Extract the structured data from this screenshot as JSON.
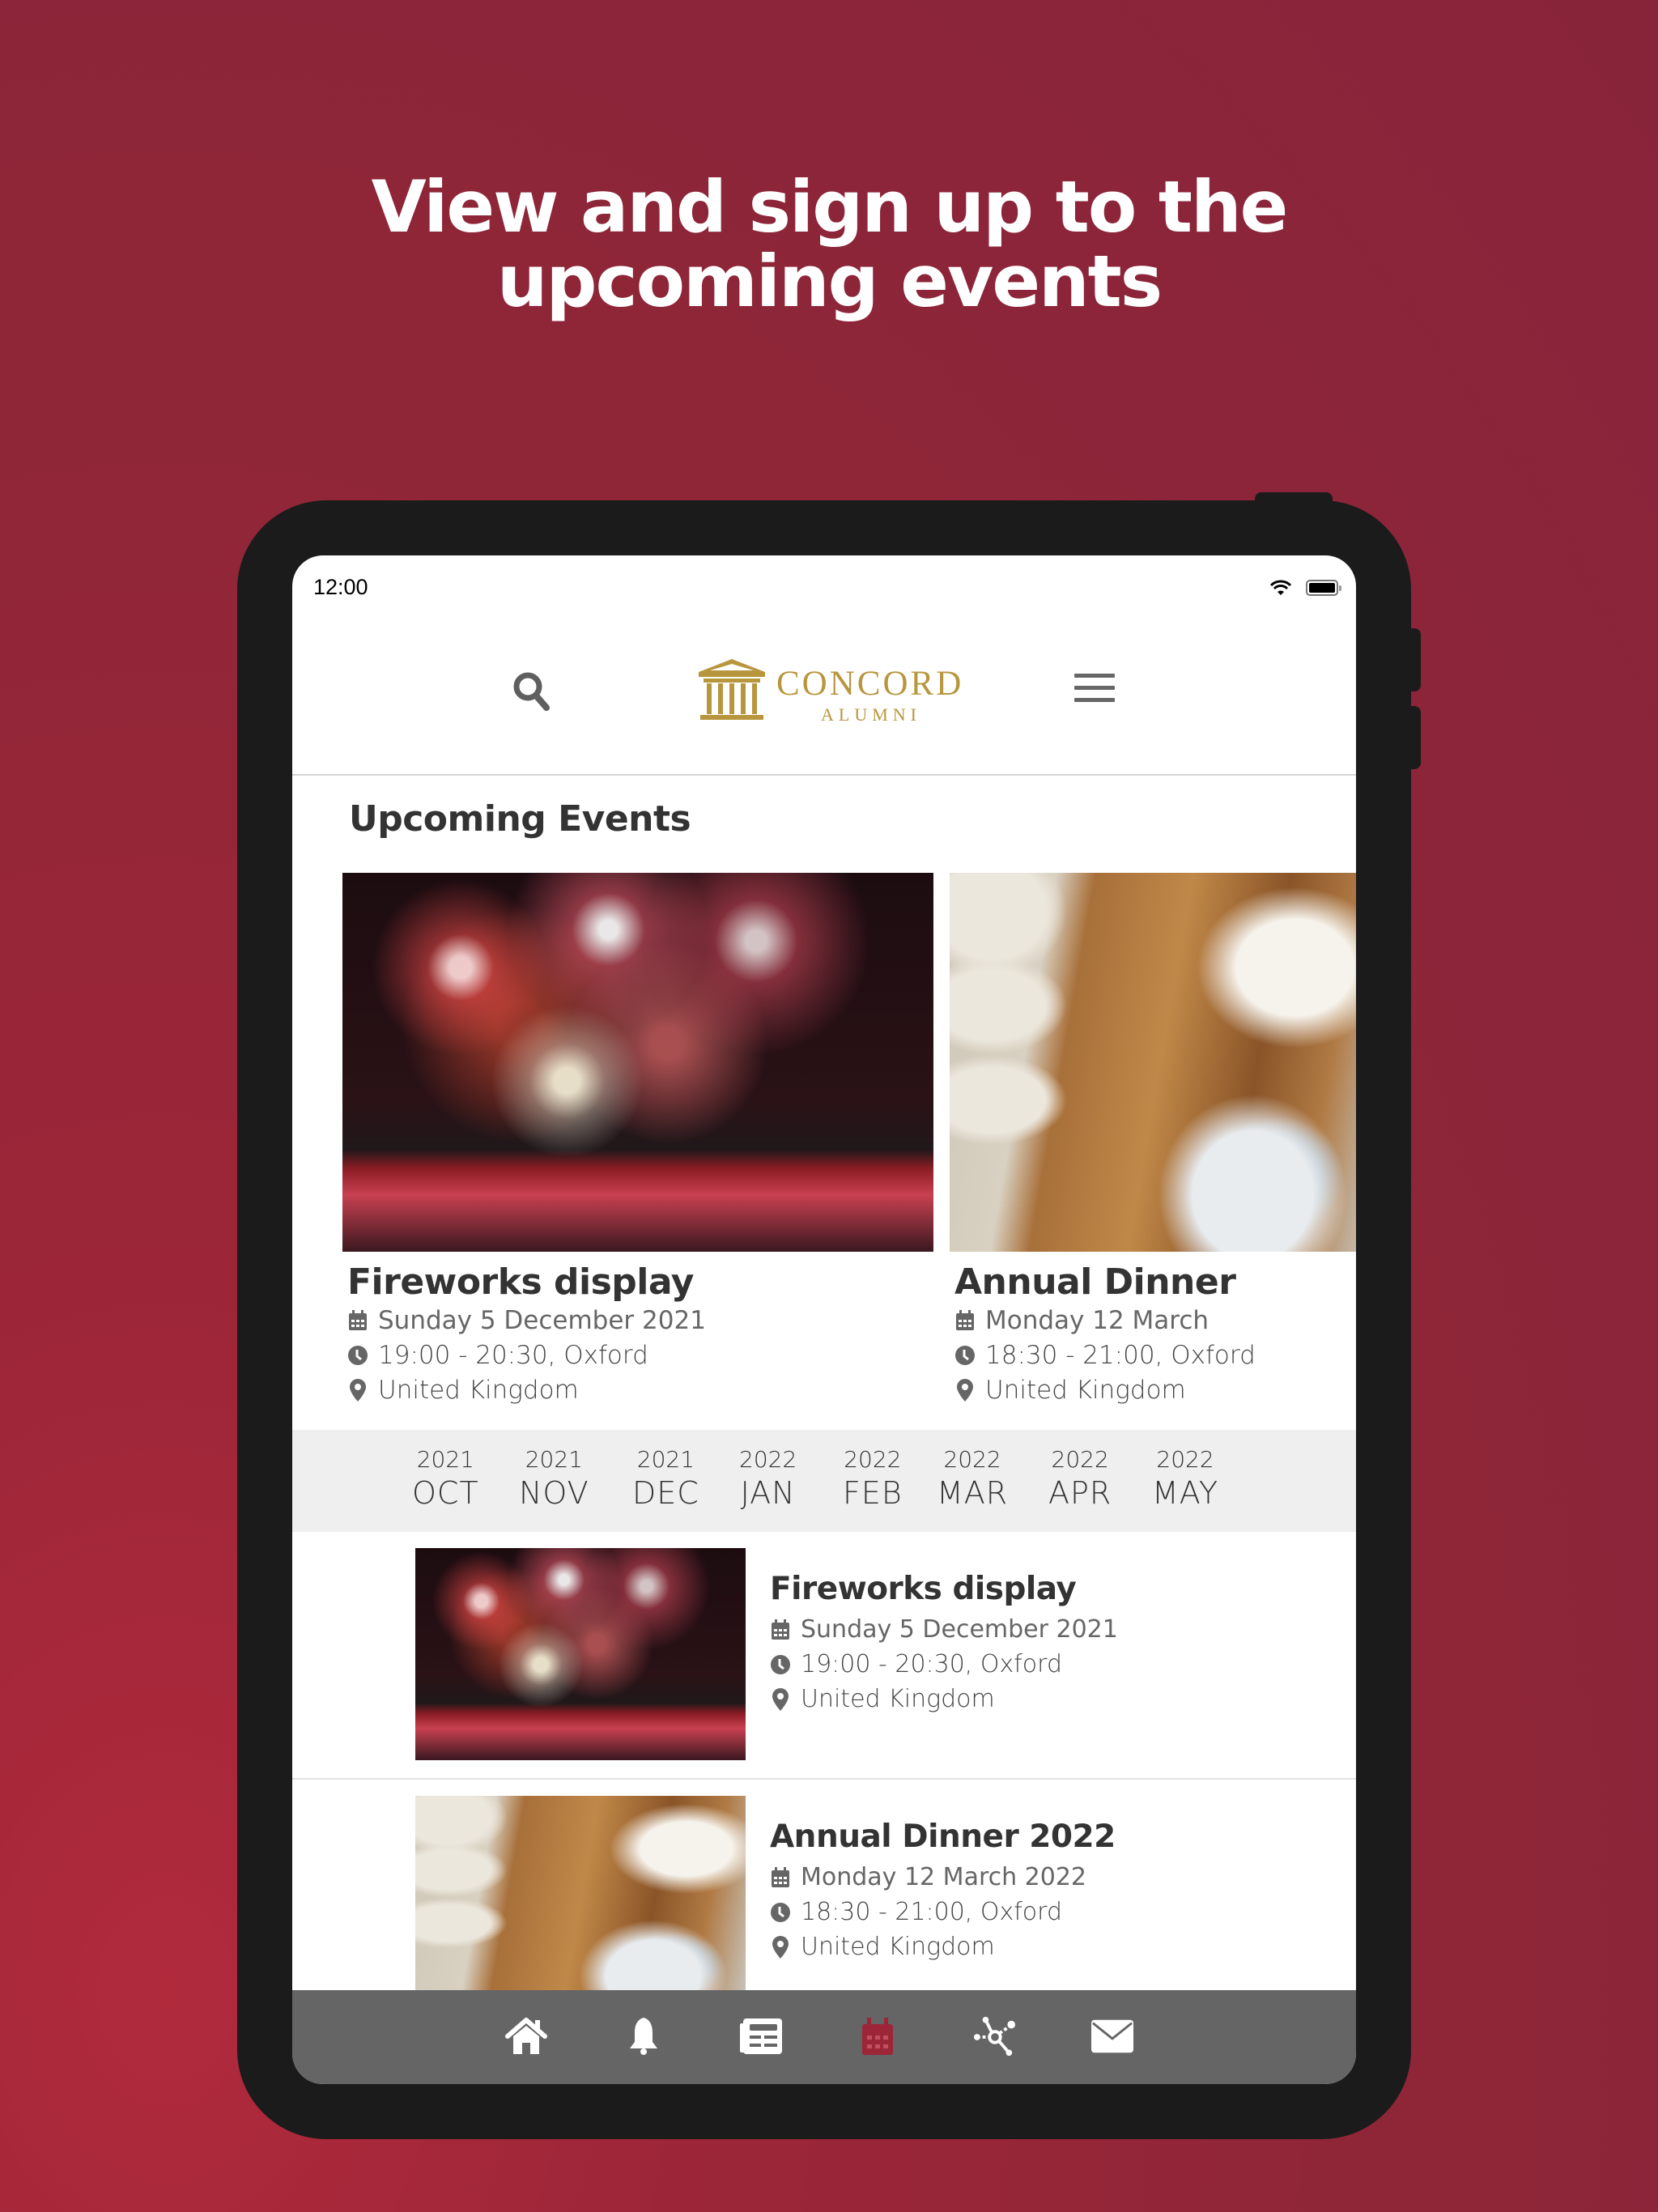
{
  "headline": {
    "line1": "View and sign up to the",
    "line2": "upcoming events"
  },
  "status_bar": {
    "time": "12:00",
    "icons": [
      "wifi-icon",
      "battery-icon"
    ]
  },
  "app_bar": {
    "logo_word": "CONCORD",
    "logo_sub": "ALUMNI",
    "left_icon": "search-icon",
    "right_icon": "hamburger-menu-icon"
  },
  "upcoming": {
    "title": "Upcoming Events",
    "cards": [
      {
        "title": "Fireworks display",
        "date": "Sunday 5 December 2021",
        "time": "19:00 - 20:30, Oxford",
        "place": "United Kingdom",
        "image": "fireworks-over-water"
      },
      {
        "title": "Annual Dinner",
        "date": "Monday 12 March",
        "time": "18:30 - 21:00, Oxford",
        "place": "United Kingdom",
        "image": "dinner-table-setting"
      }
    ]
  },
  "months": [
    {
      "year": "2021",
      "month": "OCT"
    },
    {
      "year": "2021",
      "month": "NOV"
    },
    {
      "year": "2021",
      "month": "DEC"
    },
    {
      "year": "2022",
      "month": "JAN"
    },
    {
      "year": "2022",
      "month": "FEB"
    },
    {
      "year": "2022",
      "month": "MAR"
    },
    {
      "year": "2022",
      "month": "APR"
    },
    {
      "year": "2022",
      "month": "MAY"
    }
  ],
  "event_list": [
    {
      "title": "Fireworks display",
      "date": "Sunday 5 December 2021",
      "time": "19:00 - 20:30, Oxford",
      "place": "United Kingdom",
      "image": "fireworks-over-water"
    },
    {
      "title": "Annual Dinner 2022",
      "date": "Monday 12 March 2022",
      "time": "18:30 - 21:00, Oxford",
      "place": "United Kingdom",
      "image": "dinner-table-setting"
    }
  ],
  "bottom_nav": {
    "items": [
      {
        "icon": "home-icon",
        "active": false
      },
      {
        "icon": "bell-icon",
        "active": false
      },
      {
        "icon": "newspaper-icon",
        "active": false
      },
      {
        "icon": "calendar-icon",
        "active": true
      },
      {
        "icon": "network-icon",
        "active": false
      },
      {
        "icon": "envelope-icon",
        "active": false
      }
    ]
  },
  "colors": {
    "background": "#8f2638",
    "brand_gold": "#b8963e",
    "active_nav": "#9c2638",
    "nav_bar": "#656565",
    "month_strip": "#efefef",
    "text_dark": "#333333"
  }
}
